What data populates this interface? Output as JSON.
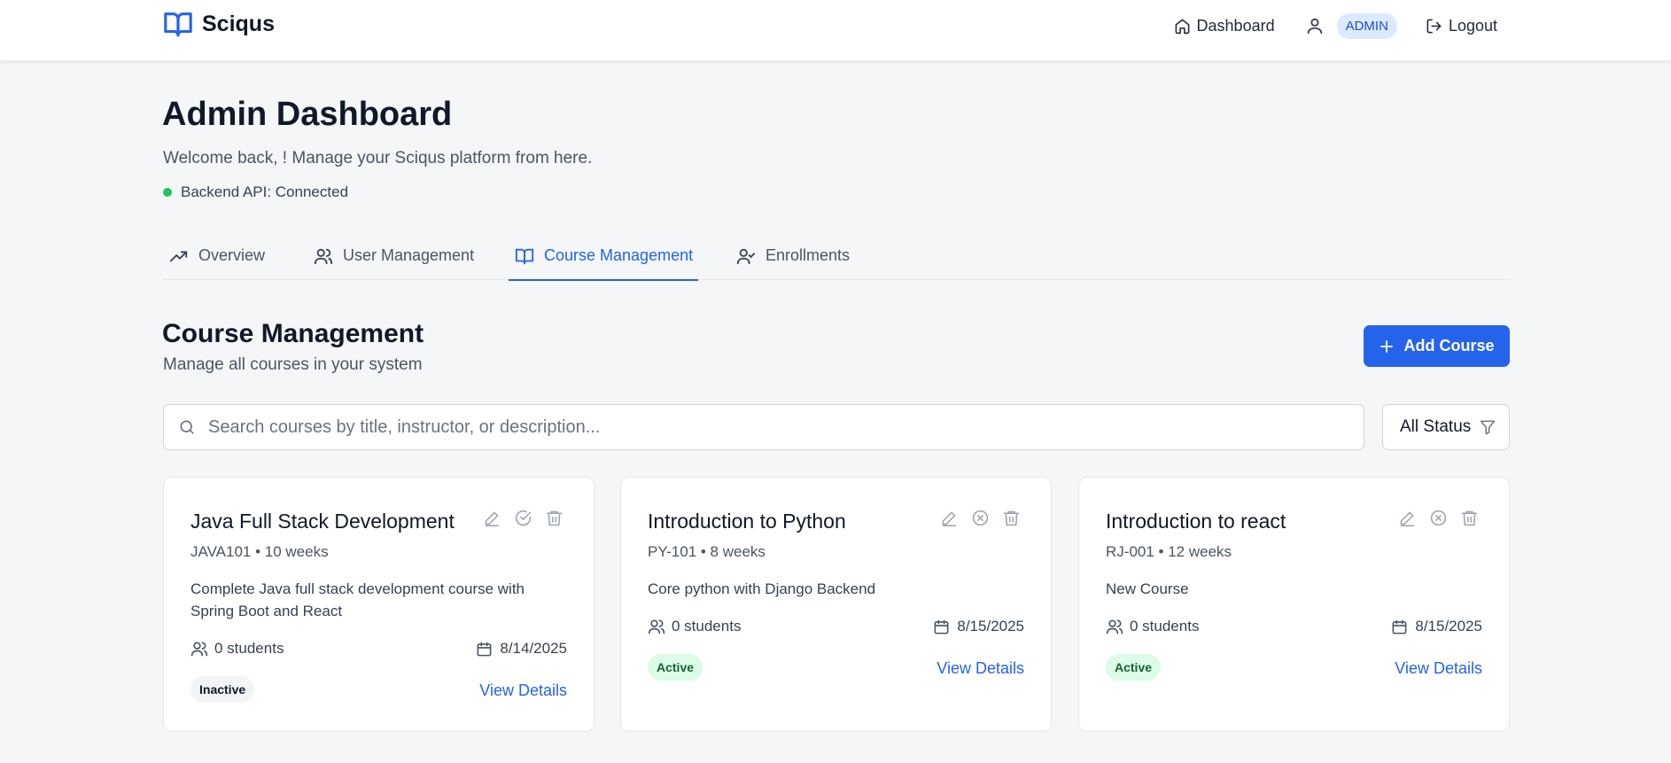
{
  "header": {
    "brand": "Sciqus",
    "nav_dashboard": "Dashboard",
    "role_badge": "ADMIN",
    "logout": "Logout"
  },
  "page": {
    "title": "Admin Dashboard",
    "welcome": "Welcome back, ! Manage your Sciqus platform from here.",
    "api_status": "Backend API: Connected"
  },
  "tabs": [
    {
      "label": "Overview",
      "icon": "trending-up-icon"
    },
    {
      "label": "User Management",
      "icon": "users-icon"
    },
    {
      "label": "Course Management",
      "icon": "book-icon",
      "active": true
    },
    {
      "label": "Enrollments",
      "icon": "user-check-icon"
    }
  ],
  "section": {
    "title": "Course Management",
    "subtitle": "Manage all courses in your system",
    "add_button": "Add Course"
  },
  "search": {
    "placeholder": "Search courses by title, instructor, or description...",
    "value": ""
  },
  "filter": {
    "selected": "All Status"
  },
  "courses": [
    {
      "title": "Java Full Stack Development",
      "meta": "JAVA101 • 10 weeks",
      "description": "Complete Java full stack development course with Spring Boot and React",
      "students": "0 students",
      "date": "8/14/2025",
      "status": "Inactive",
      "toggle_icon": "check-circle-icon",
      "view": "View Details"
    },
    {
      "title": "Introduction to Python",
      "meta": "PY-101 • 8 weeks",
      "description": "Core python with Django Backend",
      "students": "0 students",
      "date": "8/15/2025",
      "status": "Active",
      "toggle_icon": "x-circle-icon",
      "view": "View Details"
    },
    {
      "title": "Introduction to react",
      "meta": "RJ-001 • 12 weeks",
      "description": "New Course",
      "students": "0 students",
      "date": "8/15/2025",
      "status": "Active",
      "toggle_icon": "x-circle-icon",
      "view": "View Details"
    }
  ],
  "colors": {
    "accent": "#2563eb",
    "status_connected": "#22c55e",
    "active_badge_bg": "#dcfce7",
    "active_badge_text": "#166534",
    "inactive_badge_bg": "#f3f4f6"
  }
}
